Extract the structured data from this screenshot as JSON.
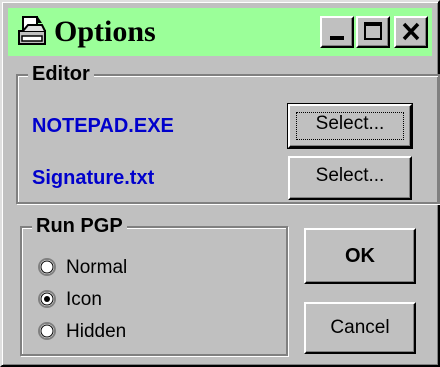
{
  "window": {
    "title": "Options",
    "controls": [
      "minimize-icon",
      "maximize-icon",
      "close-icon"
    ]
  },
  "editor": {
    "group_label": "Editor",
    "editor_file": "NOTEPAD.EXE",
    "signature_file": "Signature.txt",
    "select_editor_label": "Select...",
    "select_signature_label": "Select..."
  },
  "run_pgp": {
    "group_label": "Run PGP",
    "options": [
      {
        "label": "Normal",
        "selected": false
      },
      {
        "label": "Icon",
        "selected": true
      },
      {
        "label": "Hidden",
        "selected": false
      }
    ]
  },
  "buttons": {
    "ok_label": "OK",
    "cancel_label": "Cancel"
  },
  "colors": {
    "titlebar": "#9bff99",
    "face": "#c0c0c0",
    "file_text": "#0000cc"
  }
}
